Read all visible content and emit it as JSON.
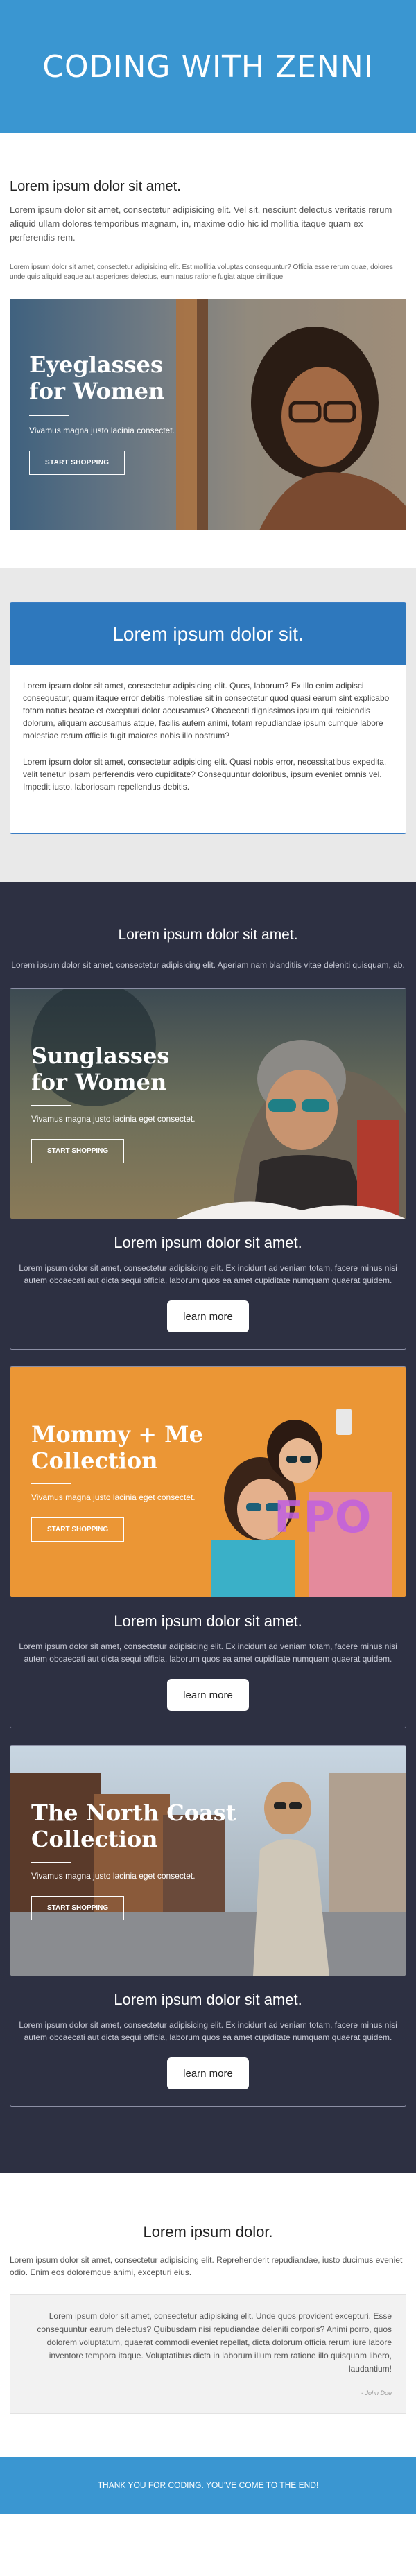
{
  "header": {
    "title": "CODING WITH ZENNI"
  },
  "intro": {
    "heading": "Lorem ipsum dolor sit amet.",
    "lead": "Lorem ipsum dolor sit amet, consectetur adipisicing elit. Vel sit, nesciunt delectus veritatis rerum aliquid ullam dolores temporibus magnam, in, maxime odio hic id mollitia itaque quam ex perferendis rem.",
    "small": "Lorem ipsum dolor sit amet, consectetur adipisicing elit. Est mollitia voluptas consequuntur? Officia esse rerum quae, dolores unde quis aliquid eaque aut asperiores delectus, eum natus ratione fugiat atque similique."
  },
  "hero": {
    "title_line1": "Eyeglasses",
    "title_line2": "for Women",
    "subtitle": "Vivamus magna justo lacinia consectet.",
    "button": "START SHOPPING"
  },
  "card": {
    "heading": "Lorem ipsum dolor sit.",
    "p1": "Lorem ipsum dolor sit amet, consectetur adipisicing elit. Quos, laborum? Ex illo enim adipisci consequatur, quam itaque error debitis molestiae sit in consectetur quod quasi earum sint explicabo totam natus beatae et excepturi dolor accusamus? Obcaecati dignissimos ipsum qui reiciendis dolorum, aliquam accusamus atque, facilis autem animi, totam repudiandae ipsum cumque labore molestiae rerum officiis fugit maiores nobis illo nostrum?",
    "p2": "Lorem ipsum dolor sit amet, consectetur adipisicing elit. Quasi nobis error, necessitatibus expedita, velit tenetur ipsam perferendis vero cupiditate? Consequuntur doloribus, ipsum eveniet omnis vel. Impedit iusto, laboriosam repellendus debitis."
  },
  "dark": {
    "heading": "Lorem ipsum dolor sit amet.",
    "intro": "Lorem ipsum dolor sit amet, consectetur adipisicing elit. Aperiam nam blanditiis vitae deleniti quisquam, ab.",
    "products": [
      {
        "title_line1": "Sunglasses",
        "title_line2": "for Women",
        "subtitle": "Vivamus magna justo lacinia eget consectet.",
        "button": "START SHOPPING",
        "heading": "Lorem ipsum dolor sit amet.",
        "text": "Lorem ipsum dolor sit amet, consectetur adipisicing elit. Ex incidunt ad veniam totam, facere minus nisi autem obcaecati aut dicta sequi officia, laborum quos ea amet cupiditate numquam quaerat quidem.",
        "cta": "learn more"
      },
      {
        "title_line1": "Mommy + Me",
        "title_line2": "Collection",
        "subtitle": "Vivamus magna justo lacinia eget consectet.",
        "button": "START SHOPPING",
        "badge": "FPO",
        "heading": "Lorem ipsum dolor sit amet.",
        "text": "Lorem ipsum dolor sit amet, consectetur adipisicing elit. Ex incidunt ad veniam totam, facere minus nisi autem obcaecati aut dicta sequi officia, laborum quos ea amet cupiditate numquam quaerat quidem.",
        "cta": "learn more"
      },
      {
        "title_line1": "The North Coast",
        "title_line2": "Collection",
        "subtitle": "Vivamus magna justo lacinia eget consectet.",
        "button": "START SHOPPING",
        "heading": "Lorem ipsum dolor sit amet.",
        "text": "Lorem ipsum dolor sit amet, consectetur adipisicing elit. Ex incidunt ad veniam totam, facere minus nisi autem obcaecati aut dicta sequi officia, laborum quos ea amet cupiditate numquam quaerat quidem.",
        "cta": "learn more"
      }
    ]
  },
  "quote_section": {
    "heading": "Lorem ipsum dolor.",
    "text": "Lorem ipsum dolor sit amet, consectetur adipisicing elit. Reprehenderit repudiandae, iusto ducimus eveniet odio. Enim eos doloremque animi, excepturi eius.",
    "quote": "Lorem ipsum dolor sit amet, consectetur adipisicing elit. Unde quos provident excepturi. Esse consequuntur earum delectus? Quibusdam nisi repudiandae deleniti corporis? Animi porro, quos dolorem voluptatum, quaerat commodi eveniet repellat, dicta dolorum officia rerum iure labore inventore tempora itaque. Voluptatibus dicta in laborum illum rem ratione illo quisquam libero, laudantium!",
    "author": "- John Doe"
  },
  "footer": {
    "text": "THANK YOU FOR CODING. YOU'VE COME TO THE END!"
  },
  "colors": {
    "brand_blue": "#3a96d1",
    "card_blue": "#2e78bd",
    "dark_bg": "#2d3042"
  }
}
